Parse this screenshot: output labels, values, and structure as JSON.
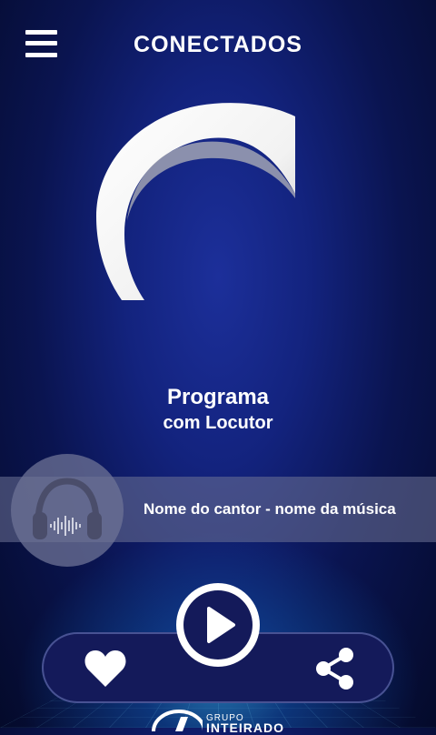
{
  "header": {
    "title": "CONECTADOS",
    "menu_icon": "hamburger-menu-icon"
  },
  "program": {
    "name": "Programa",
    "host": "com Locutor"
  },
  "now_playing": {
    "text": "Nome do cantor - nome da música",
    "icon": "headphones-icon"
  },
  "controls": {
    "like_icon": "heart-icon",
    "play_icon": "play-icon",
    "share_icon": "share-icon"
  },
  "footer": {
    "group_label": "GRUPO",
    "brand_label": "INTEIRADO"
  },
  "colors": {
    "background": "#13237e",
    "control_bar": "#141a5a",
    "text": "#ffffff"
  }
}
